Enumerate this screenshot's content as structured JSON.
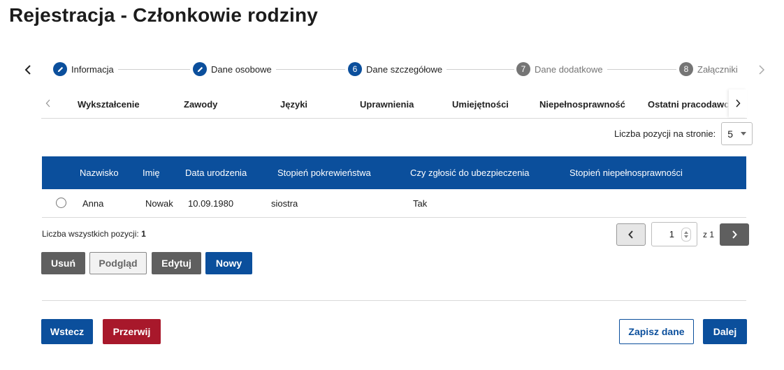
{
  "page": {
    "title": "Rejestracja - Członkowie rodziny"
  },
  "stepper": {
    "steps": [
      {
        "marker": "",
        "label": "Informacja",
        "state": "done"
      },
      {
        "marker": "",
        "label": "Dane osobowe",
        "state": "done"
      },
      {
        "marker": "6",
        "label": "Dane szczegółowe",
        "state": "active"
      },
      {
        "marker": "7",
        "label": "Dane dodatkowe",
        "state": "todo"
      },
      {
        "marker": "8",
        "label": "Załączniki",
        "state": "todo"
      }
    ]
  },
  "tabs": [
    "Wykształcenie",
    "Zawody",
    "Języki",
    "Uprawnienia",
    "Umiejętności",
    "Niepełnosprawność",
    "Ostatni pracodawca"
  ],
  "perpage": {
    "label": "Liczba pozycji na stronie:",
    "value": "5"
  },
  "table": {
    "columns": [
      "Nazwisko",
      "Imię",
      "Data urodzenia",
      "Stopień pokrewieństwa",
      "Czy zgłosić do ubezpieczenia",
      "Stopień niepełnosprawności"
    ],
    "rows": [
      [
        "Anna",
        "Nowak",
        "10.09.1980",
        "siostra",
        "Tak",
        ""
      ]
    ]
  },
  "summary": {
    "total_label": "Liczba wszystkich pozycji:",
    "total_value": "1"
  },
  "pager": {
    "current": "1",
    "of_label": "z 1"
  },
  "actions": {
    "delete": "Usuń",
    "preview": "Podgląd",
    "edit": "Edytuj",
    "new": "Nowy"
  },
  "footer": {
    "back": "Wstecz",
    "abort": "Przerwij",
    "save": "Zapisz dane",
    "next": "Dalej"
  },
  "colors": {
    "primary": "#0b4f9c",
    "danger": "#a8182b",
    "neutral": "#5f5f5f"
  },
  "icons": {
    "prev": "chevron-left-icon",
    "next": "chevron-right-icon",
    "done_step": "pencil-icon"
  }
}
